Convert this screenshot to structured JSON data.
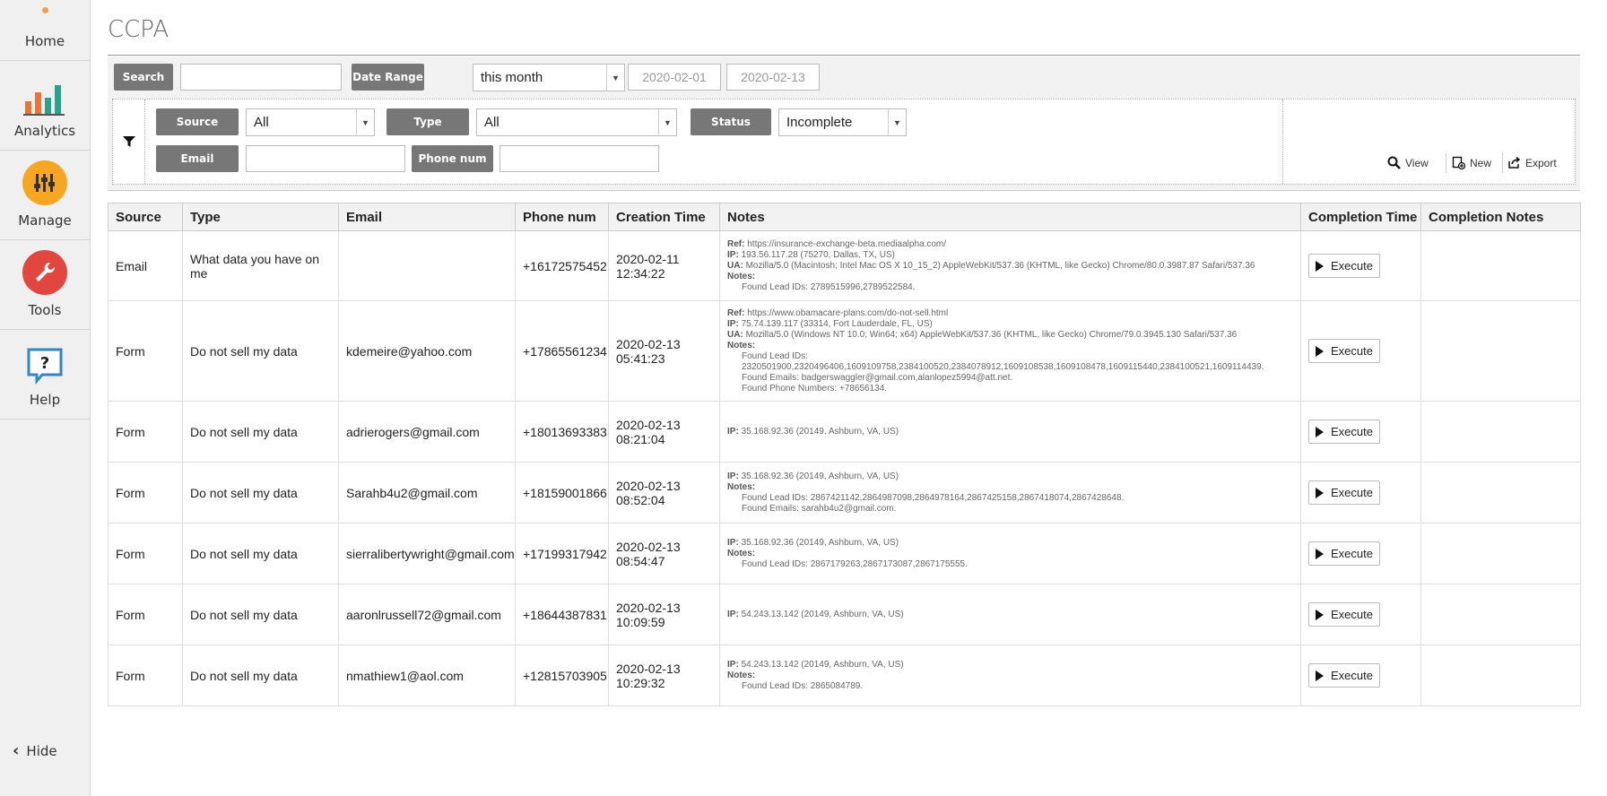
{
  "sidebar": {
    "items": [
      {
        "label": "Home",
        "icon": "home-icon"
      },
      {
        "label": "Analytics",
        "icon": "bar-chart-icon"
      },
      {
        "label": "Manage",
        "icon": "sliders-icon"
      },
      {
        "label": "Tools",
        "icon": "wrench-icon"
      },
      {
        "label": "Help",
        "icon": "help-icon"
      }
    ],
    "hide_label": "Hide"
  },
  "page": {
    "title": "CCPA"
  },
  "filters": {
    "search_label": "Search",
    "search_value": "",
    "date_range_label": "Date Range",
    "date_range_value": "this month",
    "date_from": "2020-02-01",
    "date_to": "2020-02-13",
    "source_label": "Source",
    "source_value": "All",
    "type_label": "Type",
    "type_value": "All",
    "status_label": "Status",
    "status_value": "Incomplete",
    "email_label": "Email",
    "email_value": "",
    "phone_label": "Phone num",
    "phone_value": ""
  },
  "actions": {
    "view": "View",
    "new": "New",
    "export": "Export"
  },
  "table": {
    "columns": [
      "Source",
      "Type",
      "Email",
      "Phone num",
      "Creation Time",
      "Notes",
      "Completion Time",
      "Completion Notes"
    ],
    "execute_label": "Execute",
    "rows": [
      {
        "source": "Email",
        "type": "What data you have on me",
        "email": "",
        "phone": "+16172575452",
        "created_date": "2020-02-11",
        "created_time": "12:34:22",
        "notes": [
          {
            "k": "Ref:",
            "v": "https://insurance-exchange-beta.mediaalpha.com/"
          },
          {
            "k": "IP:",
            "v": "193.56.117.28 (75270, Dallas, TX, US)"
          },
          {
            "k": "UA:",
            "v": "Mozilla/5.0 (Macintosh; Intel Mac OS X 10_15_2) AppleWebKit/537.36 (KHTML, like Gecko) Chrome/80.0.3987.87 Safari/537.36"
          },
          {
            "k": "Notes:",
            "v": ""
          },
          {
            "k": "",
            "v": "Found Lead IDs: 2789515996,2789522584."
          }
        ]
      },
      {
        "source": "Form",
        "type": "Do not sell my data",
        "email": "kdemeire@yahoo.com",
        "phone": "+17865561234",
        "created_date": "2020-02-13",
        "created_time": "05:41:23",
        "notes": [
          {
            "k": "Ref:",
            "v": "https://www.obamacare-plans.com/do-not-sell.html"
          },
          {
            "k": "IP:",
            "v": "75.74.139.117 (33314, Fort Lauderdale, FL, US)"
          },
          {
            "k": "UA:",
            "v": "Mozilla/5.0 (Windows NT 10.0; Win64; x64) AppleWebKit/537.36 (KHTML, like Gecko) Chrome/79.0.3945.130 Safari/537.36"
          },
          {
            "k": "Notes:",
            "v": ""
          },
          {
            "k": "",
            "v": "Found Lead IDs:"
          },
          {
            "k": "",
            "v": "2320501900,2320496406,1609109758,2384100520,2384078912,1609108538,1609108478,1609115440,2384100521,1609114439."
          },
          {
            "k": "",
            "v": "Found Emails: badgerswaggler@gmail.com,alanlopez5994@att.net."
          },
          {
            "k": "",
            "v": "Found Phone Numbers: +78656134."
          }
        ]
      },
      {
        "source": "Form",
        "type": "Do not sell my data",
        "email": "adrierogers@gmail.com",
        "phone": "+18013693383",
        "created_date": "2020-02-13",
        "created_time": "08:21:04",
        "notes": [
          {
            "k": "IP:",
            "v": "35.168.92.36 (20149, Ashburn, VA, US)"
          }
        ]
      },
      {
        "source": "Form",
        "type": "Do not sell my data",
        "email": "Sarahb4u2@gmail.com",
        "phone": "+18159001866",
        "created_date": "2020-02-13",
        "created_time": "08:52:04",
        "notes": [
          {
            "k": "IP:",
            "v": "35.168.92.36 (20149, Ashburn, VA, US)"
          },
          {
            "k": "Notes:",
            "v": ""
          },
          {
            "k": "",
            "v": "Found Lead IDs: 2867421142,2864987098,2864978164,2867425158,2867418074,2867428648."
          },
          {
            "k": "",
            "v": "Found Emails: sarahb4u2@gmail.com."
          }
        ]
      },
      {
        "source": "Form",
        "type": "Do not sell my data",
        "email": "sierralibertywright@gmail.com",
        "phone": "+17199317942",
        "created_date": "2020-02-13",
        "created_time": "08:54:47",
        "notes": [
          {
            "k": "IP:",
            "v": "35.168.92.36 (20149, Ashburn, VA, US)"
          },
          {
            "k": "Notes:",
            "v": ""
          },
          {
            "k": "",
            "v": "Found Lead IDs: 2867179263,2867173087,2867175555."
          }
        ]
      },
      {
        "source": "Form",
        "type": "Do not sell my data",
        "email": "aaronlrussell72@gmail.com",
        "phone": "+18644387831",
        "created_date": "2020-02-13",
        "created_time": "10:09:59",
        "notes": [
          {
            "k": "IP:",
            "v": "54.243.13.142 (20149, Ashburn, VA, US)"
          }
        ]
      },
      {
        "source": "Form",
        "type": "Do not sell my data",
        "email": "nmathiew1@aol.com",
        "phone": "+12815703905",
        "created_date": "2020-02-13",
        "created_time": "10:29:32",
        "notes": [
          {
            "k": "IP:",
            "v": "54.243.13.142 (20149, Ashburn, VA, US)"
          },
          {
            "k": "Notes:",
            "v": ""
          },
          {
            "k": "",
            "v": "Found Lead IDs: 2865084789."
          }
        ]
      }
    ]
  }
}
